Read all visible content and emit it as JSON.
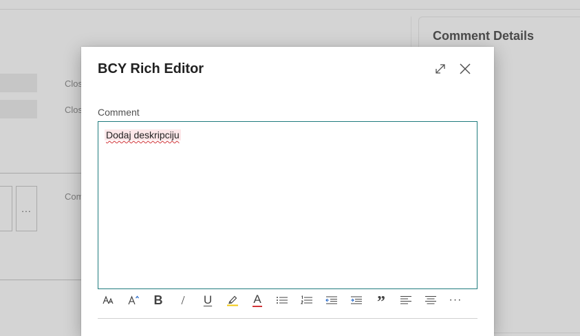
{
  "background": {
    "label_1": "Clos",
    "label_2": "Clos",
    "label_3": "Com",
    "more_label": "...",
    "side_panel_title": "Comment Details"
  },
  "dialog": {
    "title": "BCY Rich Editor",
    "field_label": "Comment",
    "editor_text": "Dodaj deskripciju",
    "expand_icon": "expand-diagonal-icon",
    "close_icon": "close-x-icon"
  },
  "toolbar": {
    "icons": [
      "font-size-icon",
      "grow-font-icon",
      "bold-icon",
      "italic-icon",
      "underline-icon",
      "highlight-icon",
      "font-color-icon",
      "bulleted-list-icon",
      "numbered-list-icon",
      "decrease-indent-icon",
      "increase-indent-icon",
      "quote-icon",
      "align-left-icon",
      "align-center-icon",
      "more-icon"
    ],
    "bold_glyph": "B",
    "italic_glyph": "/",
    "underline_glyph": "U",
    "font_color_glyph": "A",
    "quote_glyph": "”",
    "more_glyph": "···"
  },
  "colors": {
    "accent_border": "#1d7a7c",
    "highlight_yellow": "#f2c811",
    "font_color_red": "#d13438",
    "indent_blue": "#2266c8"
  }
}
